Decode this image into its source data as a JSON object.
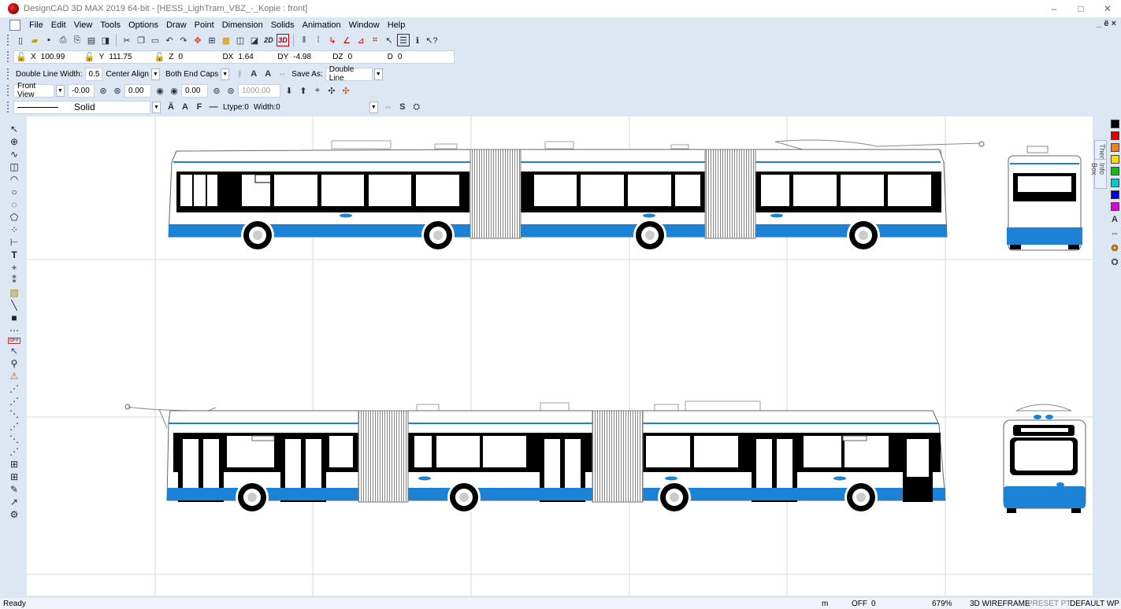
{
  "title_bar": {
    "title": "DesignCAD 3D MAX 2019 64-bit - [HESS_LighTram_VBZ_-_Kopie : front]"
  },
  "window_controls": {
    "minimize": "–",
    "restore": "□",
    "close": "✕"
  },
  "mdi_controls": "_ ё ×",
  "menu": [
    "File",
    "Edit",
    "View",
    "Tools",
    "Options",
    "Draw",
    "Point",
    "Dimension",
    "Solids",
    "Animation",
    "Window",
    "Help"
  ],
  "toolbar_main": {
    "btn_2d": "2D",
    "btn_3d": "3D"
  },
  "coords": {
    "x_label": "X",
    "x_value": "100.99",
    "y_label": "Y",
    "y_value": "111.75",
    "z_label": "Z",
    "z_value": "0",
    "dx_label": "DX",
    "dx_value": "1.64",
    "dy_label": "DY",
    "dy_value": "-4.98",
    "dz_label": "DZ",
    "dz_value": "0",
    "d_label": "D",
    "d_value": "0"
  },
  "line_options": {
    "width_label": "Double Line Width:",
    "width_value": "0.5",
    "align": "Center Align",
    "caps": "Both End Caps",
    "save_as_label": "Save As:",
    "save_as_value": "Double Line"
  },
  "view_bar": {
    "view": "Front View",
    "v1": "-0.00",
    "v2": "0.00",
    "v3": "0.00",
    "v4": "1000.00"
  },
  "style_bar": {
    "line_style": "Solid",
    "ltype": "Ltype:0",
    "width": "Width:0"
  },
  "side_tabs": {
    "themes": "Themes",
    "info_box": "Info Box"
  },
  "palette_colors": [
    "#000000",
    "#e10000",
    "#ff7f00",
    "#ffd800",
    "#00c800",
    "#00c8c8",
    "#0000e0",
    "#e000e0"
  ],
  "bus_colors": {
    "blue": "#1b82d6",
    "body": "#ffffff",
    "window": "#000000"
  },
  "status": {
    "ready": "Ready",
    "unit": "m",
    "snap": "OFF",
    "snap_value": "0",
    "zoom": "679%",
    "mode": "3D WIREFRAME",
    "preset": "PRESET PT",
    "wp": "DEFAULT WP"
  }
}
